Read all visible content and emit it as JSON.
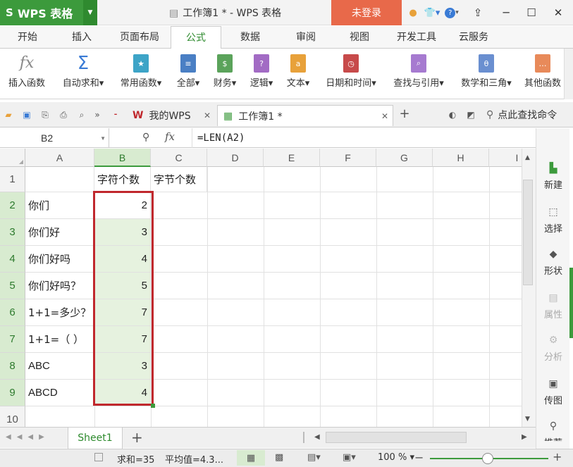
{
  "app": {
    "name": "WPS 表格",
    "window_title": "工作簿1 * - WPS 表格",
    "login_label": "未登录"
  },
  "menu_tabs": [
    "开始",
    "插入",
    "页面布局",
    "公式",
    "数据",
    "审阅",
    "视图",
    "开发工具",
    "云服务"
  ],
  "active_menu": "公式",
  "ribbon": [
    {
      "label": "插入函数",
      "icon": "fx-icon",
      "color": "#888888"
    },
    {
      "label": "自动求和",
      "icon": "sigma-icon",
      "color": "#3a7bd5",
      "dropdown": true
    },
    {
      "label": "常用函数",
      "icon": "star-book-icon",
      "color": "#3da4c7",
      "dropdown": true
    },
    {
      "label": "全部",
      "icon": "list-book-icon",
      "color": "#4a7fc4",
      "dropdown": true
    },
    {
      "label": "财务",
      "icon": "finance-book-icon",
      "color": "#5ba35b",
      "dropdown": true
    },
    {
      "label": "逻辑",
      "icon": "question-book-icon",
      "color": "#a26bc4",
      "dropdown": true
    },
    {
      "label": "文本",
      "icon": "text-book-icon",
      "color": "#e8a13a",
      "dropdown": true
    },
    {
      "label": "日期和时间",
      "icon": "clock-book-icon",
      "color": "#c74a4a",
      "dropdown": true
    },
    {
      "label": "查找与引用",
      "icon": "search-book-icon",
      "color": "#a67ad0",
      "dropdown": true
    },
    {
      "label": "数学和三角",
      "icon": "theta-book-icon",
      "color": "#6a8fd0",
      "dropdown": true
    },
    {
      "label": "其他函数",
      "icon": "more-book-icon",
      "color": "#e88a5a",
      "dropdown": false
    }
  ],
  "doc_tabs": [
    {
      "label": "我的WPS",
      "icon": "wps-logo-icon"
    },
    {
      "label": "工作簿1 *",
      "icon": "sheet-doc-icon"
    }
  ],
  "search_command": "点此查找命令",
  "namebox": "B2",
  "formula": "=LEN(A2)",
  "columns": [
    "A",
    "B",
    "C",
    "D",
    "E",
    "F",
    "G",
    "H",
    "I"
  ],
  "rows": [
    {
      "n": "1",
      "a": "",
      "b": "字符个数",
      "c": "字节个数"
    },
    {
      "n": "2",
      "a": "你们",
      "b": "2",
      "c": ""
    },
    {
      "n": "3",
      "a": "你们好",
      "b": "3",
      "c": ""
    },
    {
      "n": "4",
      "a": "你们好吗",
      "b": "4",
      "c": ""
    },
    {
      "n": "5",
      "a": "你们好吗？",
      "b": "5",
      "c": ""
    },
    {
      "n": "6",
      "a": "1+1=多少？",
      "b": "7",
      "c": ""
    },
    {
      "n": "7",
      "a": "1+1=（ ）",
      "b": "7",
      "c": ""
    },
    {
      "n": "8",
      "a": "ABC",
      "b": "3",
      "c": ""
    },
    {
      "n": "9",
      "a": "ABCD",
      "b": "4",
      "c": ""
    },
    {
      "n": "10",
      "a": "",
      "b": "",
      "c": ""
    }
  ],
  "right_panel": [
    {
      "label": "新建",
      "icon": "new-doc-icon",
      "enabled": true
    },
    {
      "label": "选择",
      "icon": "select-cursor-icon",
      "enabled": true
    },
    {
      "label": "形状",
      "icon": "shapes-icon",
      "enabled": true
    },
    {
      "label": "属性",
      "icon": "properties-icon",
      "enabled": false
    },
    {
      "label": "分析",
      "icon": "analysis-icon",
      "enabled": false
    },
    {
      "label": "传图",
      "icon": "image-upload-icon",
      "enabled": true
    },
    {
      "label": "推荐",
      "icon": "location-pin-icon",
      "enabled": true
    }
  ],
  "sheet_tab": "Sheet1",
  "status": {
    "sum": "求和=35",
    "avg": "平均值=4.3...",
    "zoom": "100 %"
  },
  "colors": {
    "accent_green": "#3c9a3c",
    "login_orange": "#e8694a",
    "selection_red": "#c0282d"
  }
}
